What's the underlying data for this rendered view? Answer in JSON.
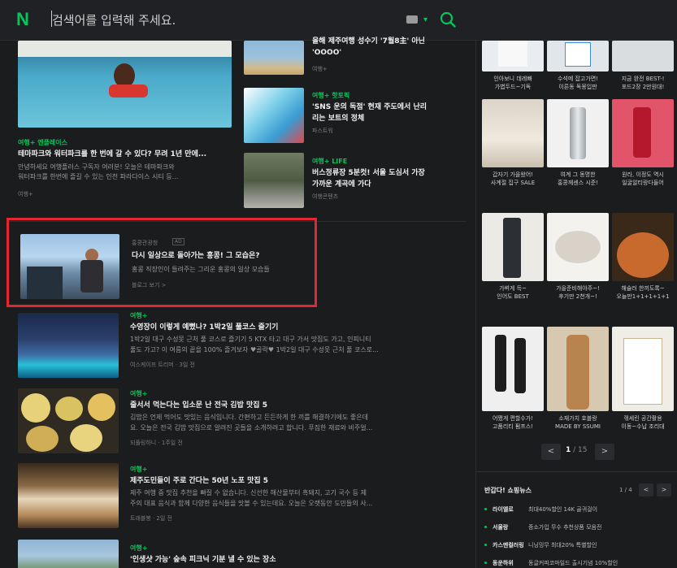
{
  "search": {
    "logo": "N",
    "placeholder": "검색어를 입력해 주세요."
  },
  "articles_top": [
    {
      "tag": "여행+ 엔플레이스",
      "title": "테마파크와 워터파크를 한 번에 갈 수 있다? 무려 1년 만에...",
      "desc1": "안녕하세요 여행플러스 구독자 여러분! 오늘은 테마파크와",
      "desc2": "워터파크를 한번에 즐길 수 있는 인천 파라다이스 시티 등...",
      "source": "여행+"
    }
  ],
  "articles_side": [
    {
      "title1": "올해 제주여행 성수기 '7월8主' 아닌",
      "title2": "'OOOO'",
      "source": "여행+"
    },
    {
      "tag": "여행+ 핫토픽",
      "title1": "'SNS 운의 독점' 현재 주도에서 난리",
      "title2": "리는 보트의 정체",
      "source": "파스트워"
    },
    {
      "tag": "여행+ LIFE",
      "title1": "버스정류장 5분컷! 서울 도심서 가장",
      "title2": "가까운 계곡에 가다",
      "source": "여행콘텐츠"
    }
  ],
  "featured": {
    "source": "홍콩관광청",
    "badge": "AD",
    "title": "다시 일상으로 돌아가는 홍콩! 그 모습은?",
    "desc": "홍콩 직장인이 들려주는 그리운 홍콩의 일상 모습들",
    "link": "블로그 보기 >"
  },
  "articles_list": [
    {
      "tag": "여행+",
      "title": "수영장이 이렇게 예뻤나? 1박2일 풀코스 즐기기",
      "desc1": "1박2일 대구 수성못 근처 풀 코스로 즐기기 5 KTX 타고 대구 가서 맛집도 가고, 인피니티",
      "desc2": "풀도 가고? 이 여름의 끝을 100% 즐겨보자 ♥골락♥ 1박2일 대구 수성못 근처 풀 코스로...",
      "source": "여스케이프 트리머 · 3일 전"
    },
    {
      "tag": "여행+",
      "title": "줄서서 먹는다는 입소문 난 전국 김밥 맛집 5",
      "desc1": "김밥은 언제 먹어도 맛있는 음식입니다. 간편하고 든든하게 한 끼를 해결하기에도 좋은데",
      "desc2": "요. 오늘은 전국 김밥 맛집으로 알려진 곳들을 소개하려고 합니다. 푸짐한 재료와 비주얼...",
      "source": "되풀링하니 · 1주일 전"
    },
    {
      "tag": "여행+",
      "title": "제주도민들이 주로 간다는 50년 노포 맛집 5",
      "desc1": "제주 여행 중 맛집 추천을 빠질 수 없습니다. 신선한 해산물부터 흑돼지, 고기 국수 등 제",
      "desc2": "주의 대표 음식과 함께 다양한 음식들을 맛볼 수 있는데요. 오늘은 오랫동안 도민들의 사...",
      "source": "트래블봉 · 2일 전"
    },
    {
      "tag": "여행+",
      "title": "'인생샷 가능' 숲속 피크닉 기분 낼 수 있는 장소"
    }
  ],
  "shopping": {
    "row1_captions": [
      [
        "인아보니 데레빠",
        "가볍두드~기독"
      ],
      [
        "수석메 잡고가면!",
        "이른동 독몽입판"
      ],
      [
        "지금 완전 BEST-!",
        "포드2장 2만원대!"
      ]
    ],
    "row2_captions": [
      [
        "갑자기 가을왔어!",
        "사계절 집구 SALE"
      ],
      [
        "여계 그 동명한",
        "홍콩께센스 시준!"
      ],
      [
        "원라, 이정도 역시",
        "일굴알티랑다들어"
      ]
    ],
    "row3_captions": [
      [
        "가벼게 득~",
        "인어도 BEST"
      ],
      [
        "가을준비해야주~!",
        "후기만 2천개~!"
      ],
      [
        "해슐러 한끼도록~",
        "오늘만1+1+1+1+1"
      ]
    ],
    "row4_captions": [
      [
        "어쨌게 편할수가!",
        "고품리티 펌프스!"
      ],
      [
        "소재가치 호블랑",
        "MADE BY SSUMI"
      ],
      [
        "꺾세린 공간활용",
        "이동~수납 조리대"
      ]
    ],
    "pager": {
      "prev": "<",
      "current": "1",
      "total": "/ 15",
      "next": ">"
    }
  },
  "shop_news": {
    "heading": "반갑다! 쇼핑뉴스",
    "pager": "1 / 4",
    "items": [
      {
        "brand": "라이엘로",
        "text": "최대40%할인 14K 골귀걸이"
      },
      {
        "brand": "서울랑",
        "text": "종소가입 무수 추천상품 모음전"
      },
      {
        "brand": "카스멘컬러링",
        "text": "니닝밍무 최대20% 특별할인"
      },
      {
        "brand": "동운하위",
        "text": "동글커피코마일드 출시기념 10%할인"
      }
    ]
  },
  "colors": {
    "accent": "#03c75a",
    "highlight": "#e3262f",
    "bg": "#1b1c1e"
  }
}
